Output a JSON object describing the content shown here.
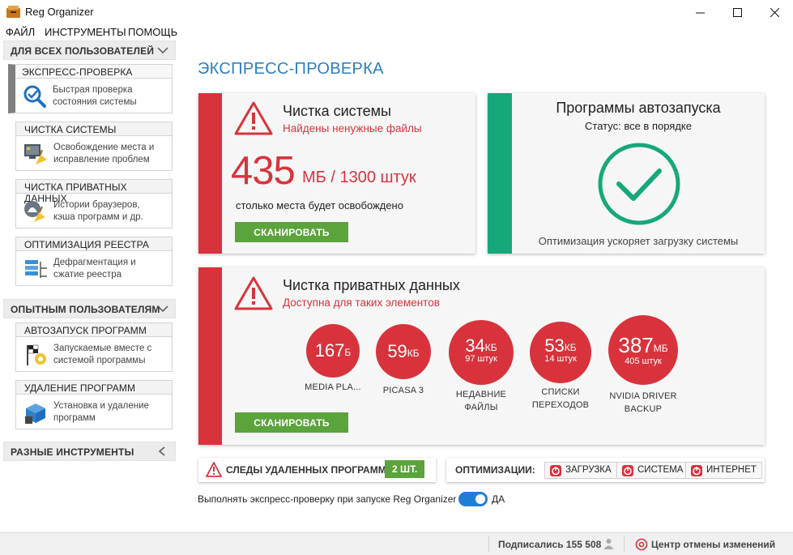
{
  "window": {
    "title": "Reg Organizer"
  },
  "menu": [
    "ФАЙЛ",
    "ИНСТРУМЕНТЫ",
    "ПОМОЩЬ"
  ],
  "sidebar": {
    "sections": [
      {
        "label": "ДЛЯ ВСЕХ ПОЛЬЗОВАТЕЛЕЙ"
      },
      {
        "label": "ОПЫТНЫМ ПОЛЬЗОВАТЕЛЯМ"
      },
      {
        "label": "РАЗНЫЕ ИНСТРУМЕНТЫ"
      }
    ],
    "tools": [
      {
        "title": "ЭКСПРЕСС-ПРОВЕРКА",
        "desc1": "Быстрая проверка",
        "desc2": "состояния системы",
        "icon": "magnifier-check-icon"
      },
      {
        "title": "ЧИСТКА СИСТЕМЫ",
        "desc1": "Освобождение места и",
        "desc2": "исправление проблем",
        "icon": "broom-screen-icon"
      },
      {
        "title": "ЧИСТКА ПРИВАТНЫХ ДАННЫХ",
        "desc1": "Истории браузеров,",
        "desc2": "кэша программ и др.",
        "icon": "privacy-broom-icon"
      },
      {
        "title": "ОПТИМИЗАЦИЯ РЕЕСТРА",
        "desc1": "Дефрагментация и",
        "desc2": "сжатие реестра",
        "icon": "registry-icon"
      },
      {
        "title": "АВТОЗАПУСК ПРОГРАММ",
        "desc1": "Запускаемые вместе с",
        "desc2": "системой программы",
        "icon": "startup-flag-icon"
      },
      {
        "title": "УДАЛЕНИЕ ПРОГРАММ",
        "desc1": "Установка и удаление",
        "desc2": "программ",
        "icon": "uninstall-box-icon"
      }
    ]
  },
  "main": {
    "title": "ЭКСПРЕСС-ПРОВЕРКА",
    "system_clean": {
      "title": "Чистка системы",
      "subtitle": "Найдены ненужные файлы",
      "amount": "435",
      "unit": "МБ / 1300 штук",
      "hint": "столько места будет освобождено",
      "button": "СКАНИРОВАТЬ"
    },
    "autostart": {
      "title": "Программы автозапуска",
      "status": "Статус: все в порядке",
      "note": "Оптимизация ускоряет загрузку системы"
    },
    "private_data": {
      "title": "Чистка приватных данных",
      "subtitle": "Доступна для таких элементов",
      "button": "СКАНИРОВАТЬ",
      "items": [
        {
          "value": "167",
          "unit": "Б",
          "count": "",
          "label1": "MEDIA PLA...",
          "label2": ""
        },
        {
          "value": "59",
          "unit": "КБ",
          "count": "",
          "label1": "PICASA 3",
          "label2": ""
        },
        {
          "value": "34",
          "unit": "КБ",
          "count": "97 штук",
          "label1": "НЕДАВНИЕ",
          "label2": "ФАЙЛЫ"
        },
        {
          "value": "53",
          "unit": "КБ",
          "count": "14 штук",
          "label1": "СПИСКИ",
          "label2": "ПЕРЕХОДОВ"
        },
        {
          "value": "387",
          "unit": "МБ",
          "count": "405 штук",
          "label1": "NVIDIA DRIVER",
          "label2": "BACKUP"
        }
      ]
    },
    "traces": {
      "label": "СЛЕДЫ УДАЛЕННЫХ ПРОГРАММ",
      "count": "2 ШТ."
    },
    "optimizations": {
      "label": "ОПТИМИЗАЦИИ:",
      "buttons": [
        "ЗАГРУЗКА",
        "СИСТЕМА",
        "ИНТЕРНЕТ"
      ]
    },
    "autocheck": {
      "label": "Выполнять экспресс-проверку при запуске Reg Organizer",
      "value": "ДА"
    }
  },
  "status": {
    "subscribers": "Подписались 155 508",
    "undo_center": "Центр отмены изменений"
  },
  "colors": {
    "accent_red": "#d8333c",
    "accent_green": "#16a87b",
    "button_green": "#5ba33b",
    "title_blue": "#2c7fc1"
  }
}
